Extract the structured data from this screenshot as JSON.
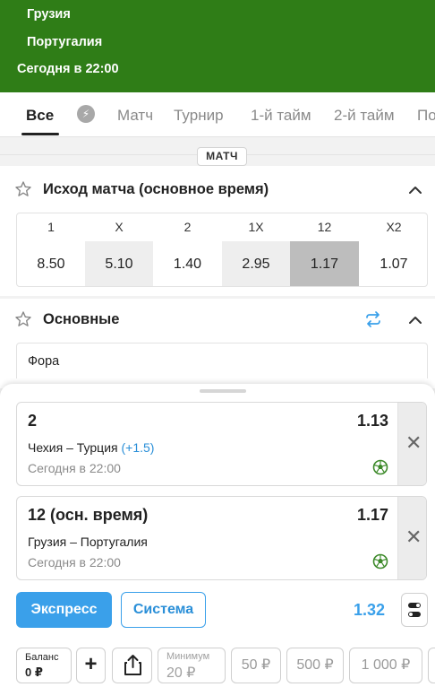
{
  "header": {
    "team1": "Грузия",
    "team2": "Португалия",
    "datetime": "Сегодня в 22:00",
    "bg_color": "#2f7d17"
  },
  "tabs": [
    "Все",
    "Матч",
    "Турнир",
    "1-й тайм",
    "2-й тайм",
    "По"
  ],
  "tab_icon": "lightning-icon",
  "section_label": "МАТЧ",
  "market_outcome": {
    "title": "Исход матча (основное время)",
    "headers": [
      "1",
      "X",
      "2",
      "1X",
      "12",
      "X2"
    ],
    "odds": [
      "8.50",
      "5.10",
      "1.40",
      "2.95",
      "1.17",
      "1.07"
    ],
    "selected_index": 4
  },
  "market_main": {
    "title": "Основные",
    "row_label": "Фора"
  },
  "betslip": {
    "bets": [
      {
        "name": "2",
        "coef": "1.13",
        "teams": "Чехия – Турция",
        "handicap": "(+1.5)",
        "time": "Сегодня в 22:00"
      },
      {
        "name": "12 (осн. время)",
        "coef": "1.17",
        "teams": "Грузия – Португалия",
        "handicap": "",
        "time": "Сегодня в 22:00"
      }
    ],
    "express_label": "Экспресс",
    "system_label": "Система",
    "total_coef": "1.32",
    "balance_label": "Баланс",
    "balance_value": "0 ₽",
    "plus_label": "+",
    "minimum_label": "Минимум",
    "minimum_value": "20 ₽",
    "quick_amounts": [
      "50 ₽",
      "500 ₽",
      "1 000 ₽"
    ],
    "accent_color": "#3aa0ea"
  }
}
